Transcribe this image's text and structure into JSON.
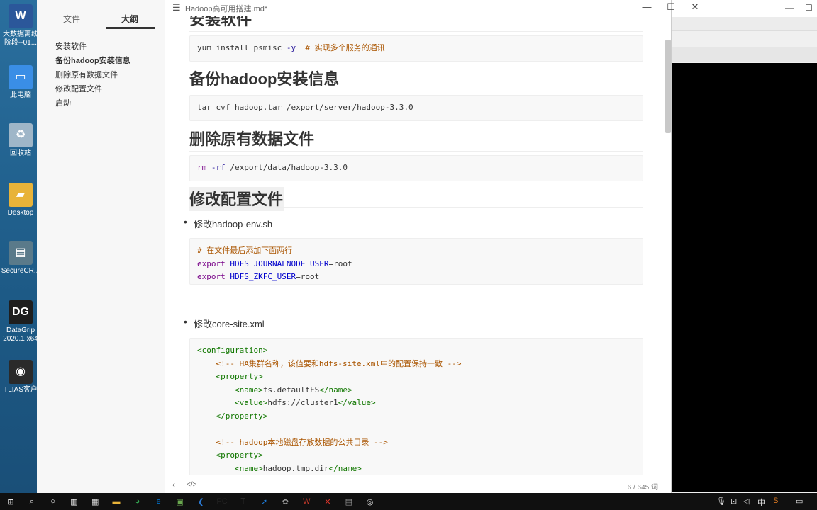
{
  "window": {
    "title": "Hadoop高可用搭建.md*",
    "word_count": "6 / 645 词"
  },
  "sidebar": {
    "tab_files": "文件",
    "tab_outline": "大纲",
    "outline": [
      {
        "label": "安装软件",
        "current": false
      },
      {
        "label": "备份hadoop安装信息",
        "current": true
      },
      {
        "label": "删除原有数据文件",
        "current": false
      },
      {
        "label": "修改配置文件",
        "current": false
      },
      {
        "label": "启动",
        "current": false
      }
    ]
  },
  "document": {
    "h_install": "安装软件",
    "code_install_cmd": "yum install psmisc ",
    "code_install_flag": "-y",
    "code_install_comment": "  # 实现多个服务的通讯",
    "h_backup": "备份hadoop安装信息",
    "code_backup": "tar cvf hadoop.tar /export/server/hadoop-3.3.0",
    "h_delete": "删除原有数据文件",
    "code_delete_cmd": "rm",
    "code_delete_flag": "-rf",
    "code_delete_path": " /export/data/hadoop-3.3.0",
    "h_config": "修改配置文件",
    "li_env": "修改hadoop-env.sh",
    "env_comment": "# 在文件最后添加下面两行",
    "env_line1_kw": "export",
    "env_line1_var": "HDFS_JOURNALNODE_USER",
    "env_line1_val": "=root",
    "env_line2_kw": "export",
    "env_line2_var": "HDFS_ZKFC_USER",
    "env_line2_val": "=root",
    "li_core": "修改core-site.xml",
    "xml_open_config": "<configuration>",
    "xml_comment1": "<!-- HA集群名称，该值要和hdfs-site.xml中的配置保持一致 -->",
    "xml_prop_open1": "<property>",
    "xml_name_open": "<name>",
    "xml_name1_val": "fs.defaultFS",
    "xml_name_close": "</name>",
    "xml_value_open": "<value>",
    "xml_value1_val": "hdfs://cluster1",
    "xml_value_close": "</value>",
    "xml_prop_close1": "</property>",
    "xml_comment2": "<!-- hadoop本地磁盘存放数据的公共目录 -->",
    "xml_prop_open2": "<property>",
    "xml_name2_val": "hadoop.tmp.dir"
  },
  "desktop_icons": [
    {
      "label": "大数据离线\n阶段--01...",
      "icon": "word-doc-icon",
      "color": "#2b579a",
      "glyph": "W"
    },
    {
      "label": "此电脑",
      "icon": "computer-icon",
      "color": "#3a8ee6",
      "glyph": "▭"
    },
    {
      "label": "回收站",
      "icon": "recycle-bin-icon",
      "color": "#9fb6c8",
      "glyph": "♻"
    },
    {
      "label": "Desktop",
      "icon": "folder-icon",
      "color": "#e8b339",
      "glyph": "▰"
    },
    {
      "label": "SecureCR...",
      "icon": "securecrt-icon",
      "color": "#5a7a8a",
      "glyph": "▤"
    },
    {
      "label": "DataGrip\n2020.1 x64",
      "icon": "datagrip-icon",
      "color": "#1e1e1e",
      "glyph": "DG"
    },
    {
      "label": "TLIAS客户",
      "icon": "tlias-icon",
      "color": "#2a2a2a",
      "glyph": "◉"
    }
  ],
  "taskbar": {
    "clock_lang": "中",
    "items": [
      "windows-icon",
      "search-icon",
      "cortana-icon",
      "task-view-icon",
      "store-icon",
      "explorer-icon",
      "chrome-icon",
      "edge-icon",
      "app-icon",
      "vscode-icon",
      "pycharm-icon",
      "typora-icon",
      "app2-icon",
      "app3-icon",
      "app4-icon",
      "app5-icon",
      "app6-icon",
      "app7-icon"
    ]
  }
}
